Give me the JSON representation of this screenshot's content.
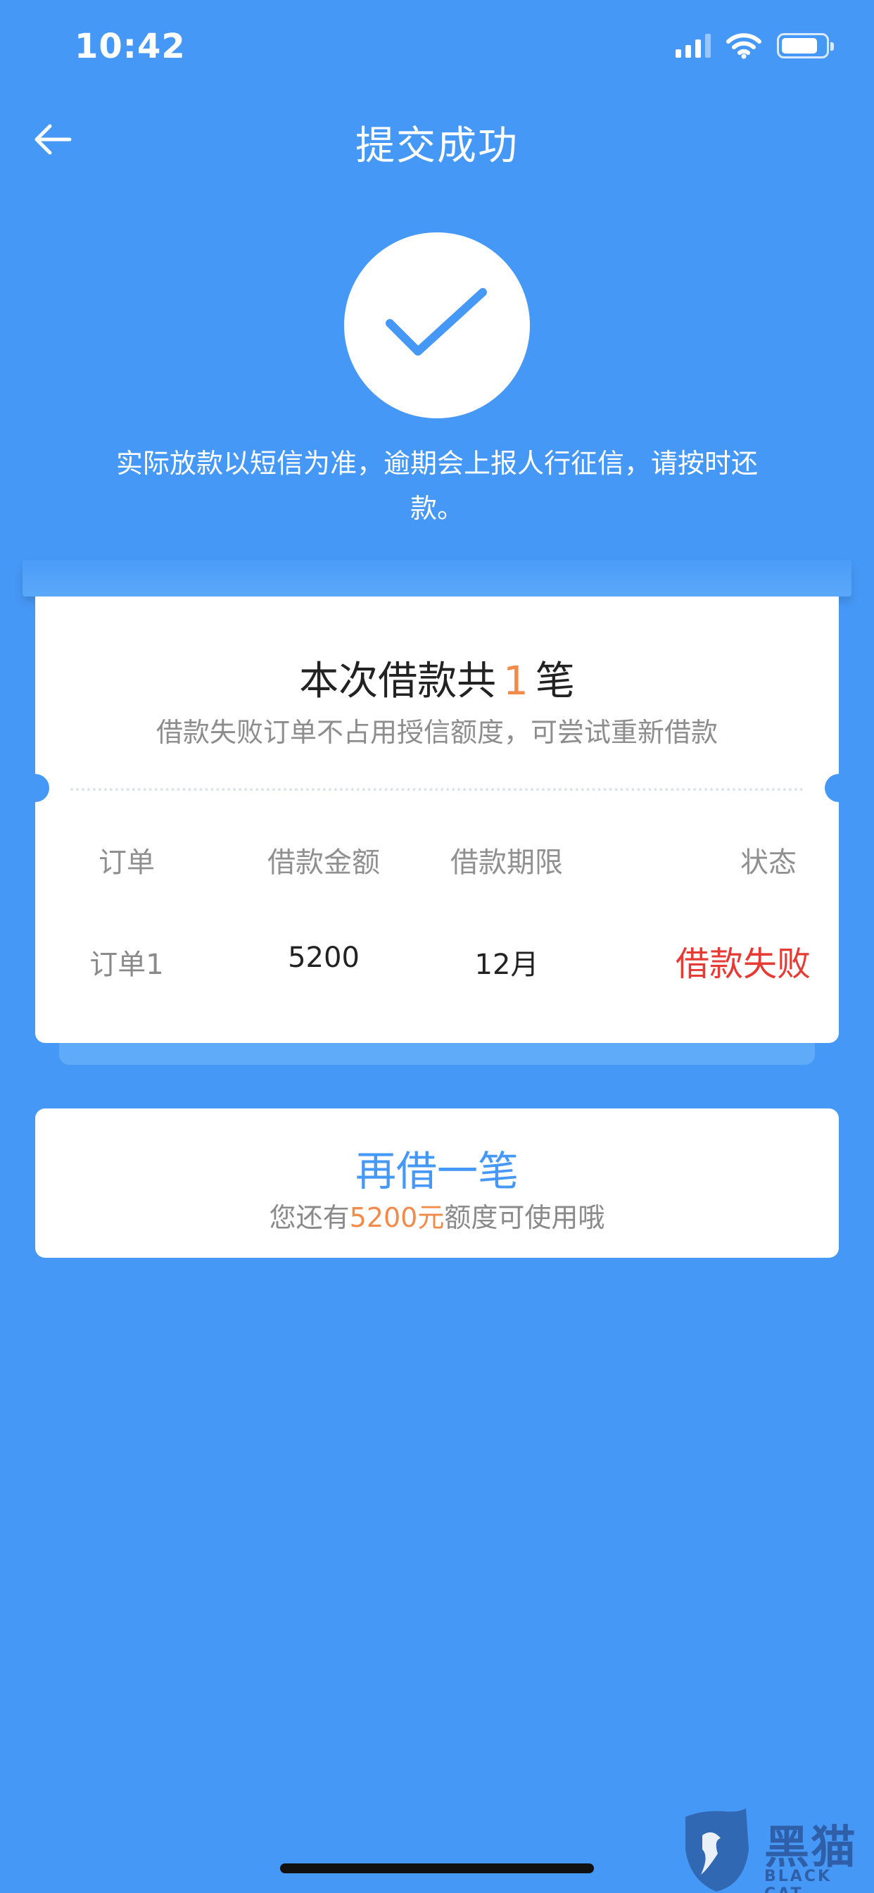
{
  "status_bar": {
    "time": "10:42"
  },
  "nav": {
    "title": "提交成功"
  },
  "notice": "实际放款以短信为准，逾期会上报人行征信，请按时还款。",
  "summary": {
    "title_prefix": "本次借款共",
    "count": "1",
    "title_suffix": "笔",
    "subtitle": "借款失败订单不占用授信额度，可尝试重新借款"
  },
  "table": {
    "headers": [
      "订单",
      "借款金额",
      "借款期限",
      "状态"
    ],
    "rows": [
      {
        "order": "订单1",
        "amount": "5200",
        "term": "12月",
        "status": "借款失败"
      }
    ]
  },
  "borrow_again": {
    "title": "再借一笔",
    "sub_prefix": "您还有",
    "sub_amount": "5200元",
    "sub_suffix": "额度可使用哦"
  },
  "watermark": {
    "cn": "黑猫",
    "en": "BLACK CAT"
  },
  "colors": {
    "background": "#4698f6",
    "accent_orange": "#f28a4a",
    "error_red": "#e63b34"
  }
}
